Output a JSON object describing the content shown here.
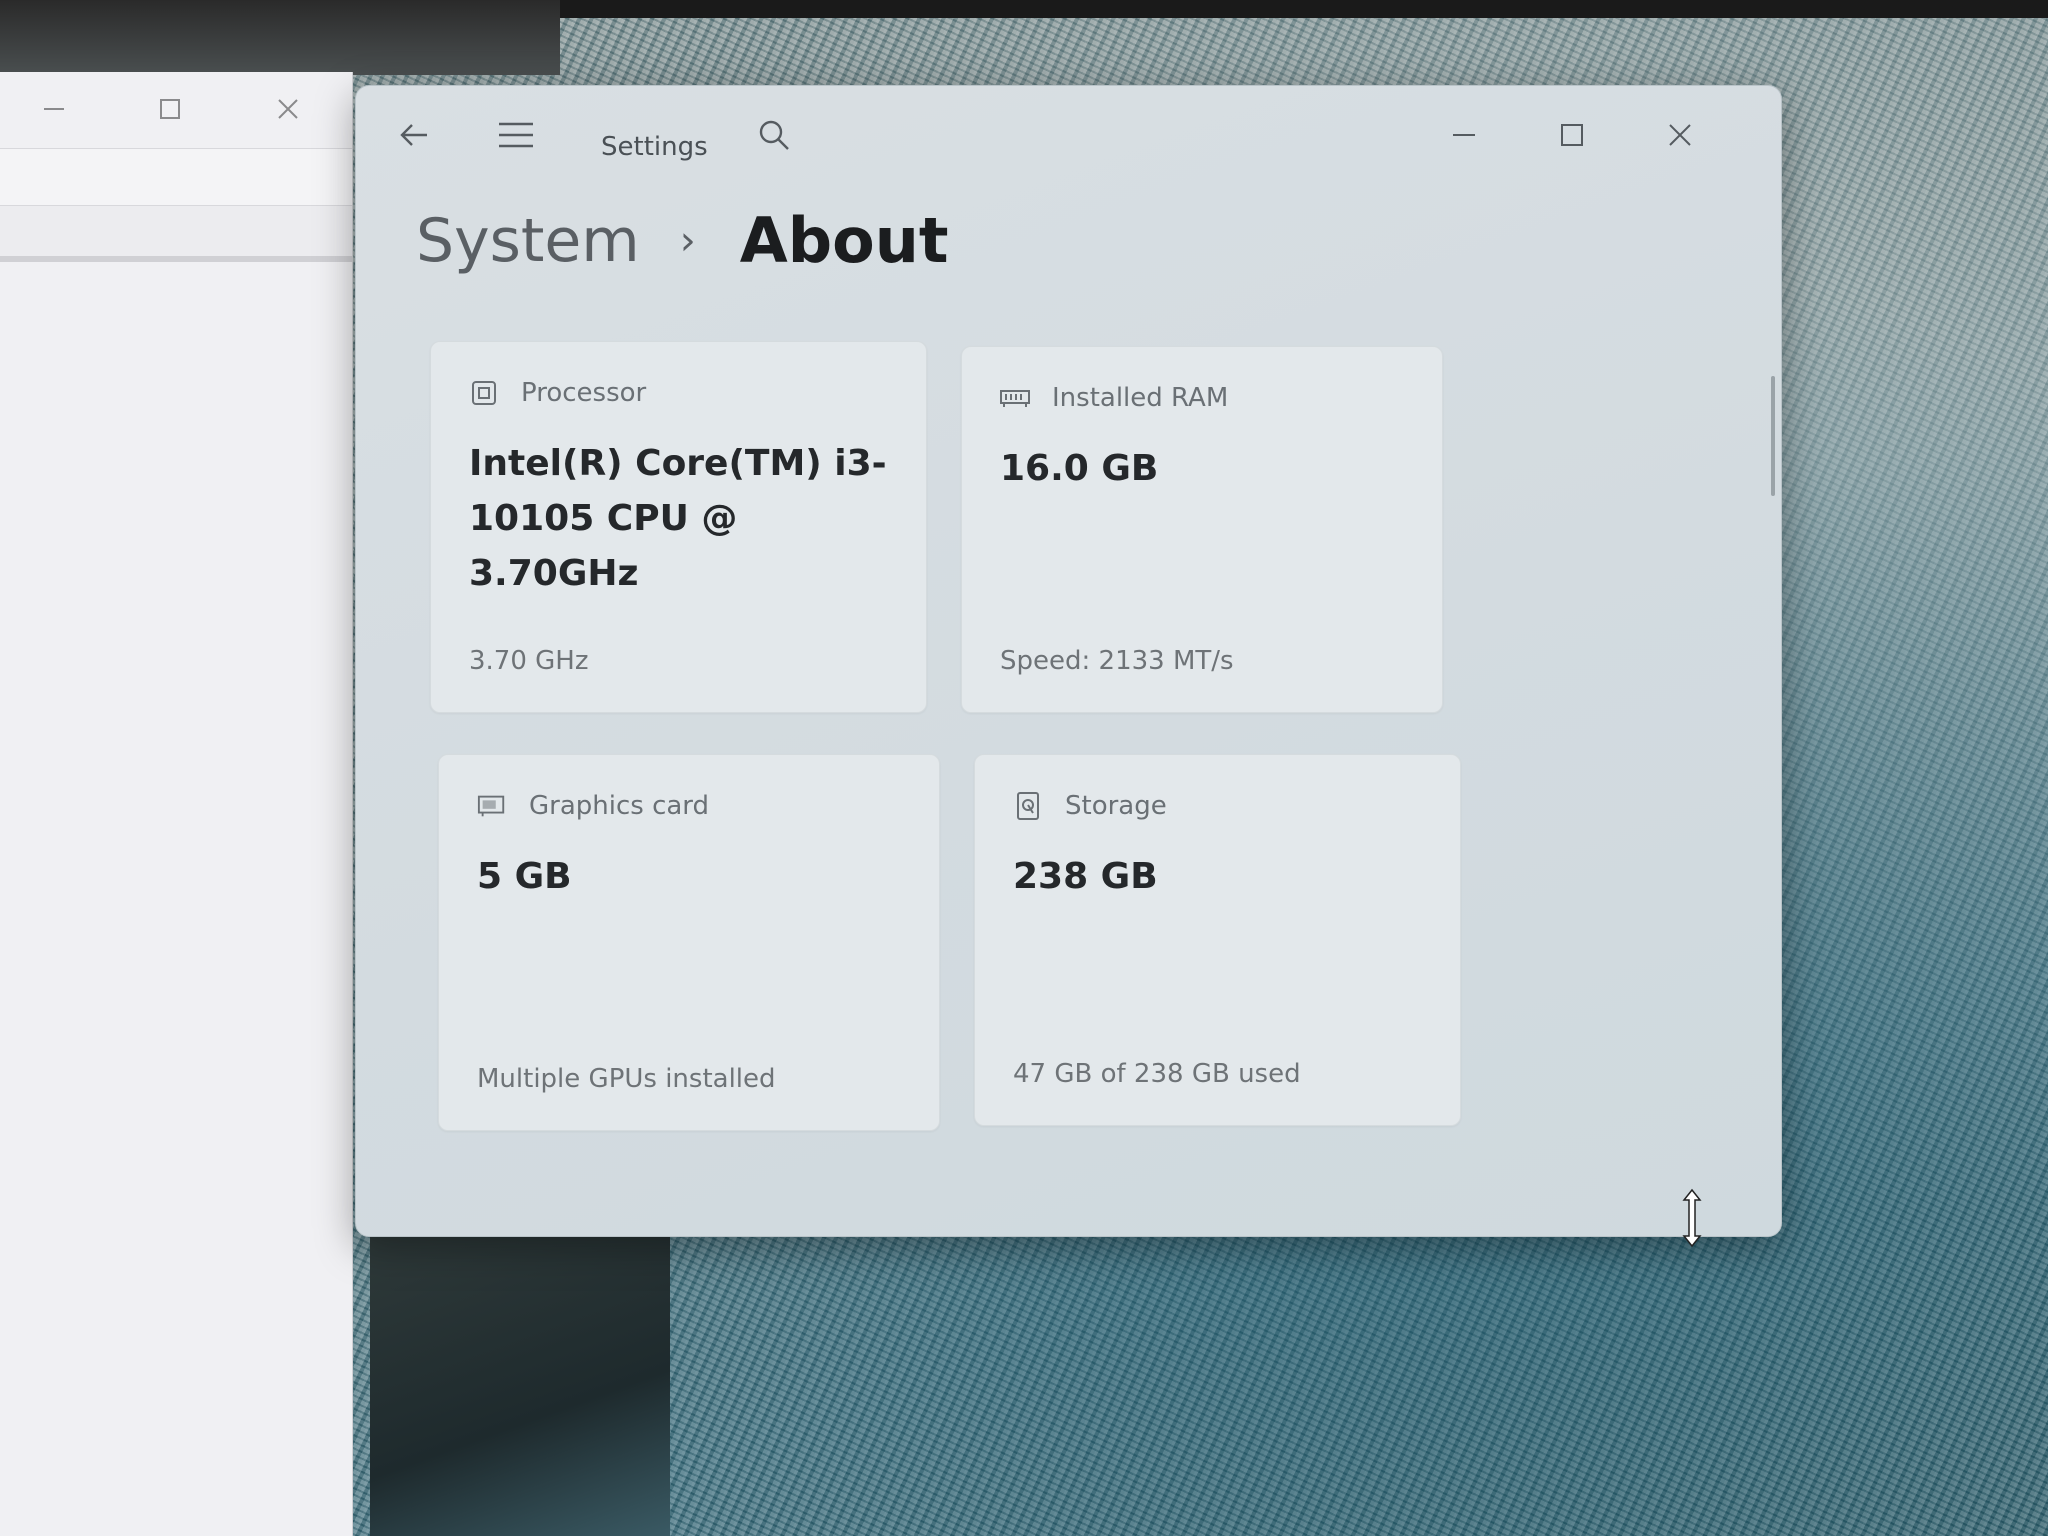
{
  "background_window": {
    "minimize_icon": "minimize-icon",
    "maximize_icon": "maximize-icon",
    "close_icon": "close-icon"
  },
  "settings": {
    "app_title": "Settings",
    "breadcrumb": {
      "parent": "System",
      "separator": "›",
      "current": "About"
    },
    "cards": {
      "processor": {
        "label": "Processor",
        "value": "Intel(R) Core(TM) i3-10105 CPU @ 3.70GHz",
        "sub": "3.70 GHz",
        "icon": "processor-icon"
      },
      "ram": {
        "label": "Installed RAM",
        "value": "16.0 GB",
        "sub": "Speed: 2133 MT/s",
        "icon": "ram-icon"
      },
      "graphics": {
        "label": "Graphics card",
        "value": "5 GB",
        "sub": "Multiple GPUs installed",
        "icon": "graphics-card-icon"
      },
      "storage": {
        "label": "Storage",
        "value": "238 GB",
        "sub": "47 GB of 238 GB used",
        "icon": "storage-icon"
      }
    }
  },
  "colors": {
    "window_bg": "#d9dfe3",
    "card_bg": "#e3e8eb",
    "text_primary": "#1b1d1f",
    "text_secondary": "#6a7075"
  }
}
